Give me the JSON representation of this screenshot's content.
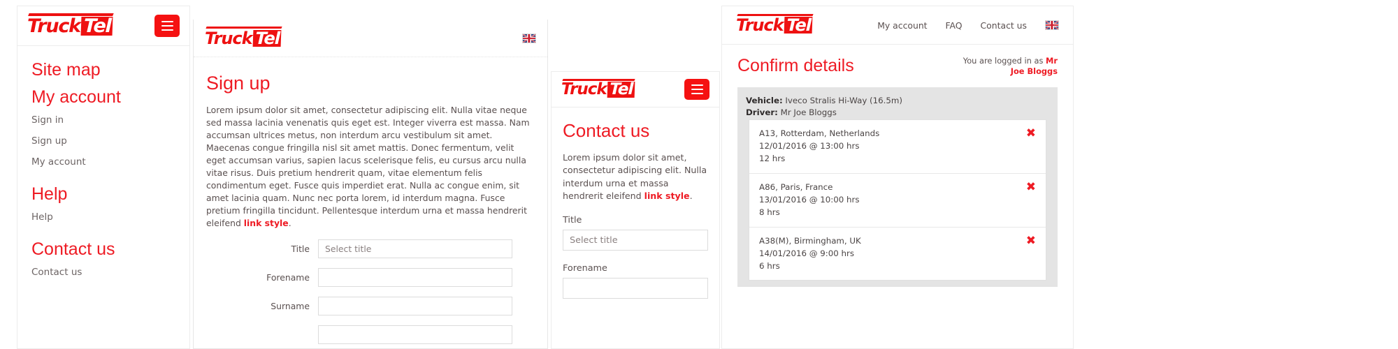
{
  "brand": {
    "name_a": "Truck",
    "name_b": "Tel",
    "red": "#ee1b24",
    "button_red": "#f51111"
  },
  "panel_sidebar": {
    "menu_icon": "hamburger-icon",
    "sections": [
      {
        "heading": "Site map",
        "items": []
      },
      {
        "heading": "My account",
        "items": [
          "Sign in",
          "Sign up",
          "My account"
        ]
      },
      {
        "heading": "Help",
        "items": [
          "Help"
        ]
      },
      {
        "heading": "Contact us",
        "items": [
          "Contact us"
        ]
      }
    ]
  },
  "panel_signup": {
    "flag_icon": "union-jack-flag-icon",
    "title": "Sign up",
    "paragraph": "Lorem ipsum dolor sit amet, consectetur adipiscing elit. Nulla vitae neque sed massa lacinia venenatis quis eget est. Integer viverra est massa. Nam accumsan ultrices metus, non interdum arcu vestibulum sit amet. Maecenas congue fringilla nisl sit amet mattis. Donec fermentum, velit eget accumsan varius, sapien lacus scelerisque felis, eu cursus arcu nulla vitae risus. Duis pretium hendrerit quam, vitae elementum felis condimentum eget. Fusce quis imperdiet erat. Nulla ac congue enim, sit amet lacinia quam. Nunc nec porta lorem, id interdum magna. Fusce pretium fringilla tincidunt. Pellentesque interdum urna et massa hendrerit eleifend ",
    "link_text": "link style",
    "paragraph_tail": ".",
    "fields": [
      {
        "label": "Title",
        "value": "Select title"
      },
      {
        "label": "Forename",
        "value": ""
      },
      {
        "label": "Surname",
        "value": ""
      },
      {
        "label": "",
        "value": ""
      }
    ]
  },
  "panel_contact": {
    "menu_icon": "hamburger-icon",
    "title": "Contact us",
    "paragraph": "Lorem ipsum dolor sit amet, consectetur adipiscing elit. Nulla interdum urna et massa hendrerit eleifend ",
    "link_text": "link style",
    "paragraph_tail": ".",
    "fields": [
      {
        "label": "Title",
        "value": "Select title"
      },
      {
        "label": "Forename",
        "value": ""
      }
    ]
  },
  "panel_confirm": {
    "nav": [
      "My account",
      "FAQ",
      "Contact us"
    ],
    "flag_icon": "union-jack-flag-icon",
    "title": "Confirm details",
    "logged_in_prefix": "You are logged in as ",
    "logged_in_user": "Mr Joe Bloggs",
    "summary": {
      "vehicle_label": "Vehicle:",
      "vehicle_value": " Iveco Stralis Hi-Way (16.5m)",
      "driver_label": "Driver:",
      "driver_value": " Mr Joe Bloggs"
    },
    "remove_icon": "remove-x-icon",
    "routes": [
      {
        "location": "A13, Rotterdam, Netherlands",
        "datetime": "12/01/2016 @ 13:00 hrs",
        "duration": "12 hrs",
        "remove": "✖"
      },
      {
        "location": "A86, Paris, France",
        "datetime": "13/01/2016 @ 10:00 hrs",
        "duration": "8 hrs",
        "remove": "✖"
      },
      {
        "location": "A38(M), Birmingham, UK",
        "datetime": "14/01/2016 @ 9:00 hrs",
        "duration": "6 hrs",
        "remove": "✖"
      }
    ]
  }
}
